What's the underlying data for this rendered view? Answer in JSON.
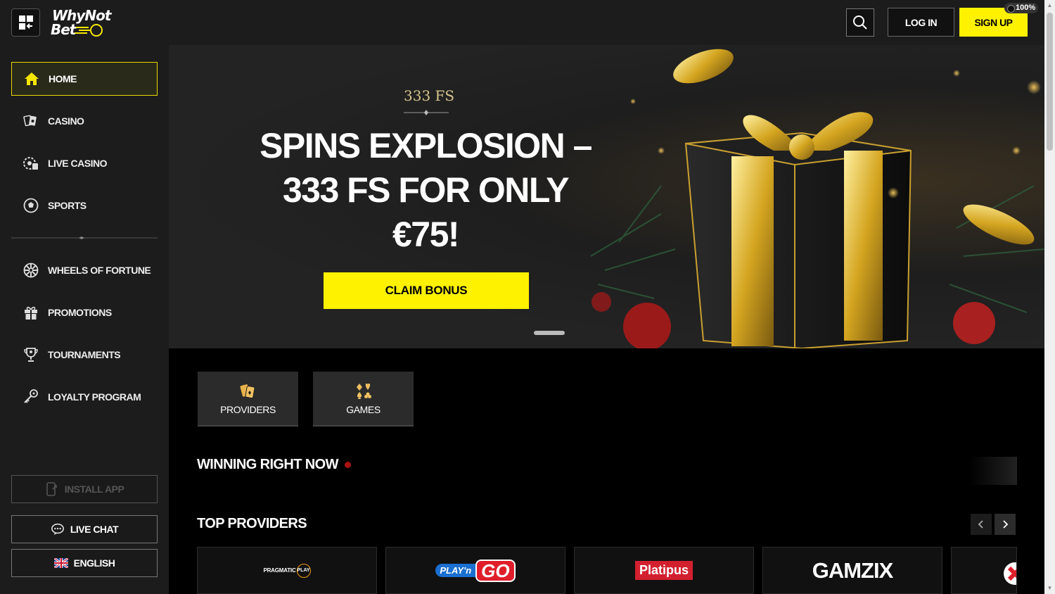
{
  "header": {
    "logo_line1": "WhyNot",
    "logo_line2": "Bet",
    "login_label": "LOG IN",
    "signup_label": "SIGN UP",
    "zoom_level": "100%"
  },
  "sidebar": {
    "items": [
      {
        "label": "HOME",
        "icon": "home-icon",
        "active": true
      },
      {
        "label": "CASINO",
        "icon": "casino-cards-icon"
      },
      {
        "label": "LIVE CASINO",
        "icon": "live-casino-icon"
      },
      {
        "label": "SPORTS",
        "icon": "soccer-ball-icon"
      },
      {
        "label": "WHEELS OF FORTUNE",
        "icon": "wheel-icon"
      },
      {
        "label": "PROMOTIONS",
        "icon": "gift-icon"
      },
      {
        "label": "TOURNAMENTS",
        "icon": "trophy-icon"
      },
      {
        "label": "LOYALTY PROGRAM",
        "icon": "key-icon"
      }
    ],
    "install_app_label": "INSTALL APP",
    "live_chat_label": "LIVE CHAT",
    "language_label": "ENGLISH"
  },
  "hero": {
    "eyebrow": "333 FS",
    "title": "SPINS EXPLOSION – 333 FS FOR ONLY €75!",
    "cta_label": "CLAIM BONUS"
  },
  "categories": {
    "providers_label": "PROVIDERS",
    "games_label": "GAMES"
  },
  "sections": {
    "winning_title": "WINNING RIGHT NOW",
    "top_providers_title": "TOP PROVIDERS"
  },
  "providers": [
    {
      "name": "PRAGMATIC PLAY",
      "text": "PRAGMATIC",
      "badge": "PLAY"
    },
    {
      "name": "PLAY'N GO",
      "text": "PLAY'n",
      "badge": "GO"
    },
    {
      "name": "Platipus",
      "text": "Platipus"
    },
    {
      "name": "GAMZIX",
      "text": "GAMZIX"
    }
  ],
  "colors": {
    "accent_yellow": "#fff200",
    "sidebar_bg": "#1c1c1c",
    "page_bg": "#000000"
  }
}
